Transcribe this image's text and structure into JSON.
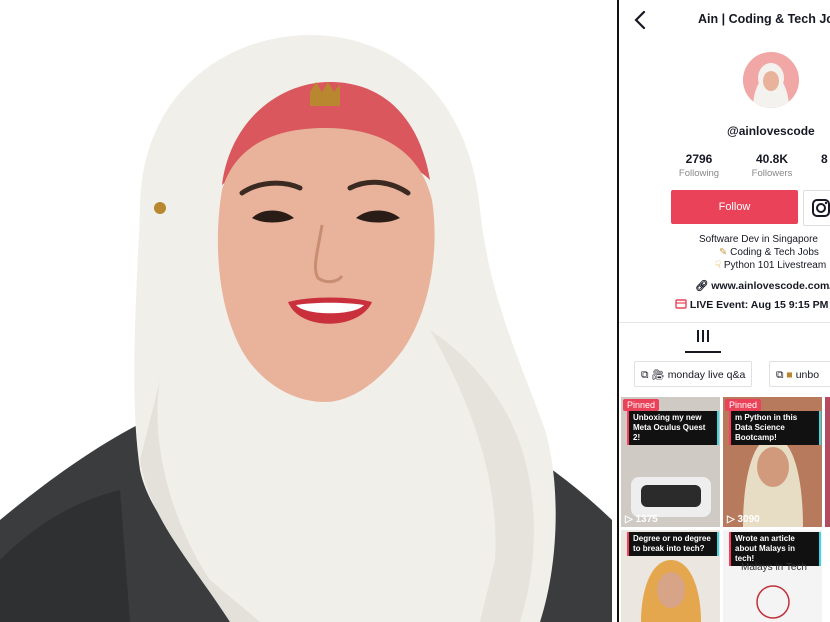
{
  "header": {
    "title": "Ain | Coding & Tech Jobs"
  },
  "profile": {
    "handle": "@ainlovescode",
    "stats": [
      {
        "value": "2796",
        "label": "Following"
      },
      {
        "value": "40.8K",
        "label": "Followers"
      },
      {
        "value": "8",
        "label": ""
      }
    ],
    "follow_label": "Follow",
    "bio": [
      "Software Dev in Singapore",
      "Coding & Tech Jobs",
      "Python 101 Livestream"
    ],
    "link": "www.ainlovescode.com/li",
    "live_event": "LIVE Event: Aug 15 9:15 PM"
  },
  "playlists": [
    {
      "label": "monday live q&a"
    },
    {
      "label": "unbo"
    }
  ],
  "videos": [
    {
      "pinned": "Pinned",
      "caption": "Unboxing my new Meta Oculus Quest 2!",
      "count": "1375"
    },
    {
      "pinned": "Pinned",
      "caption": "m Python in this Data Science Bootcamp!",
      "count": "3090"
    },
    {
      "pinned": "",
      "caption": "Degree or no degree to break into tech?",
      "count": ""
    },
    {
      "pinned": "",
      "caption": "Wrote an article about Malays in tech!",
      "count": ""
    }
  ],
  "tile_extra": {
    "text": "Malays in Tech"
  },
  "colors": {
    "accent": "#ea4359",
    "text": "#161823"
  }
}
